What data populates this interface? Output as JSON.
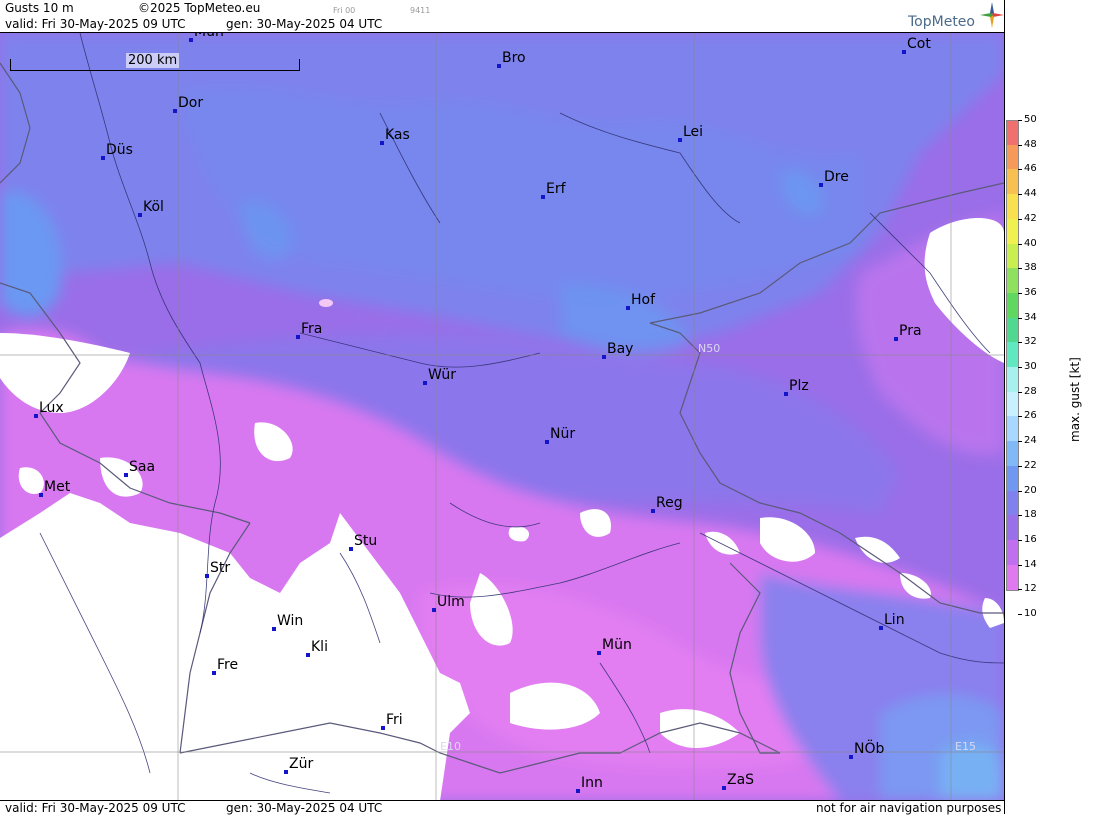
{
  "header": {
    "title": "Gusts 10 m",
    "copyright": "©2025 TopMeteo.eu",
    "run": "Fri 00",
    "code": "9411",
    "valid": "valid:  Fri  30-May-2025  09 UTC",
    "gen": "gen: 30-May-2025 04 UTC",
    "logo": "TopMeteo"
  },
  "footer": {
    "valid": "valid:  Fri  30-May-2025  09 UTC",
    "gen": "gen: 30-May-2025 04 UTC",
    "disclaimer": "not for air navigation purposes"
  },
  "scale": {
    "label": "200 km"
  },
  "grid_labels": [
    "N50",
    "E10",
    "E15"
  ],
  "cities": [
    {
      "name": "Mün_top",
      "label": "Mün"
    },
    {
      "name": "Bro",
      "label": "Bro"
    },
    {
      "name": "Cot",
      "label": "Cot"
    },
    {
      "name": "Dor",
      "label": "Dor"
    },
    {
      "name": "Kas",
      "label": "Kas"
    },
    {
      "name": "Lei",
      "label": "Lei"
    },
    {
      "name": "Düs",
      "label": "Düs"
    },
    {
      "name": "Erf",
      "label": "Erf"
    },
    {
      "name": "Dre",
      "label": "Dre"
    },
    {
      "name": "Köl",
      "label": "Köl"
    },
    {
      "name": "Hof",
      "label": "Hof"
    },
    {
      "name": "Fra",
      "label": "Fra"
    },
    {
      "name": "Pra",
      "label": "Pra"
    },
    {
      "name": "Bay",
      "label": "Bay"
    },
    {
      "name": "Wür",
      "label": "Wür"
    },
    {
      "name": "Plz",
      "label": "Plz"
    },
    {
      "name": "Lux",
      "label": "Lux"
    },
    {
      "name": "Nür",
      "label": "Nür"
    },
    {
      "name": "Saa",
      "label": "Saa"
    },
    {
      "name": "Met",
      "label": "Met"
    },
    {
      "name": "Reg",
      "label": "Reg"
    },
    {
      "name": "Stu",
      "label": "Stu"
    },
    {
      "name": "Str",
      "label": "Str"
    },
    {
      "name": "Ulm",
      "label": "Ulm"
    },
    {
      "name": "Win",
      "label": "Win"
    },
    {
      "name": "Lin",
      "label": "Lin"
    },
    {
      "name": "Kli",
      "label": "Kli"
    },
    {
      "name": "Mün",
      "label": "Mün"
    },
    {
      "name": "Fre",
      "label": "Fre"
    },
    {
      "name": "Fri",
      "label": "Fri"
    },
    {
      "name": "NÖb",
      "label": "NÖb"
    },
    {
      "name": "Zür",
      "label": "Zür"
    },
    {
      "name": "Inn",
      "label": "Inn"
    },
    {
      "name": "ZaS",
      "label": "ZaS"
    }
  ],
  "legend": {
    "unit": "max. gust [kt]",
    "ticks": [
      "50",
      "48",
      "46",
      "44",
      "42",
      "40",
      "38",
      "36",
      "34",
      "32",
      "30",
      "28",
      "26",
      "24",
      "22",
      "20",
      "18",
      "16",
      "14",
      "12",
      "10"
    ],
    "colors": [
      "#f07070",
      "#f59a5a",
      "#f8c050",
      "#f8e050",
      "#f0f050",
      "#c8ee50",
      "#90e060",
      "#60d860",
      "#50d890",
      "#60e8c0",
      "#a8f0f0",
      "#c8f0ff",
      "#a8d8ff",
      "#80b8f8",
      "#7098f0",
      "#8080ee",
      "#9a70ea",
      "#c070ee",
      "#e078f0",
      "#ffffff"
    ]
  },
  "colors": {
    "low": "#e07ef0",
    "mid": "#9b6ee8",
    "high": "#7d82ec",
    "higher": "#6a9af2"
  }
}
